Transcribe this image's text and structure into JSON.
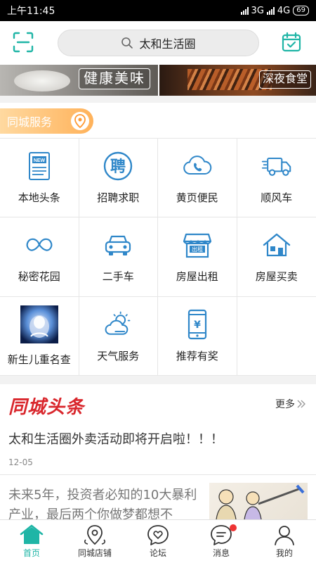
{
  "status_bar": {
    "time": "上午11:45",
    "net1": "3G",
    "net2": "4G",
    "battery": "69"
  },
  "header": {
    "search_text": "太和生活圈"
  },
  "banner": {
    "left_tag": "健康美味",
    "right_tag": "深夜食堂"
  },
  "section": {
    "title": "同城服务"
  },
  "services": [
    {
      "label": "本地头条",
      "icon": "news-icon"
    },
    {
      "label": "招聘求职",
      "icon": "recruit-icon"
    },
    {
      "label": "黄页便民",
      "icon": "phone-icon"
    },
    {
      "label": "顺风车",
      "icon": "truck-icon"
    },
    {
      "label": "秘密花园",
      "icon": "mustache-icon"
    },
    {
      "label": "二手车",
      "icon": "car-icon"
    },
    {
      "label": "房屋出租",
      "icon": "rent-shop-icon"
    },
    {
      "label": "房屋买卖",
      "icon": "house-icon"
    },
    {
      "label": "新生儿重名查",
      "icon": "photo-thumbnail"
    },
    {
      "label": "天气服务",
      "icon": "weather-icon"
    },
    {
      "label": "推荐有奖",
      "icon": "mobile-yuan-icon"
    }
  ],
  "news": {
    "logo_text": "同城头条",
    "more_label": "更多",
    "item1_title": "太和生活圈外卖活动即将开启啦！！！",
    "item1_date": "12-05",
    "item2_title": "未来5年，投资者必知的10大暴利产业，最后两个你做梦都想不"
  },
  "tabs": [
    {
      "label": "首页",
      "icon": "home-icon",
      "active": true
    },
    {
      "label": "同城店铺",
      "icon": "location-icon",
      "active": false
    },
    {
      "label": "论坛",
      "icon": "heart-chat-icon",
      "active": false
    },
    {
      "label": "消息",
      "icon": "message-icon",
      "active": false
    },
    {
      "label": "我的",
      "icon": "user-icon",
      "active": false
    }
  ],
  "colors": {
    "accent": "#1fb5a6",
    "icon_blue": "#2f87c9",
    "badge_red": "#e33333",
    "section_orange": "#ffb25a"
  }
}
